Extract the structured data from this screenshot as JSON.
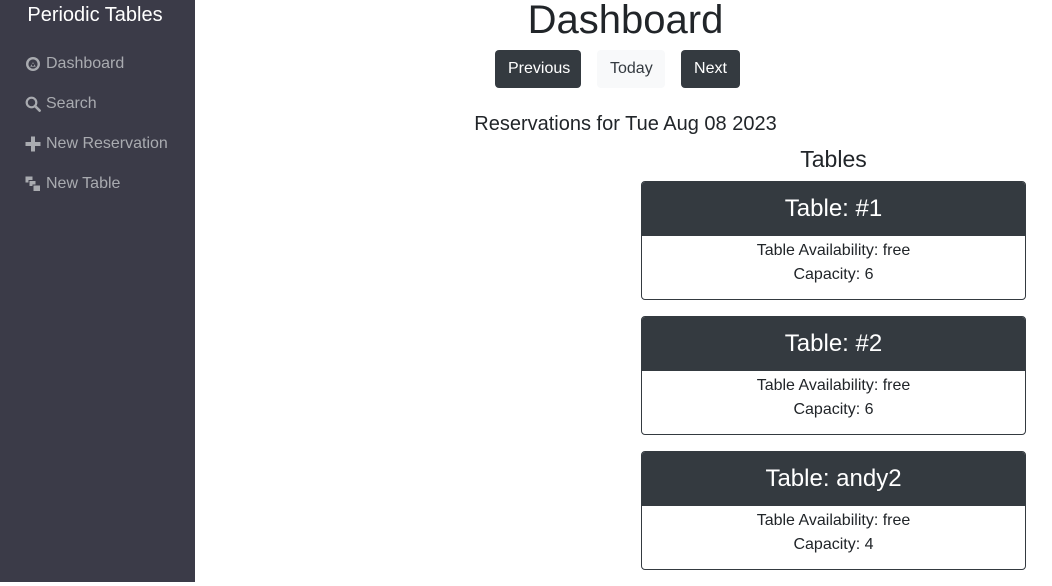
{
  "sidebar": {
    "brand": "Periodic Tables",
    "items": [
      {
        "label": "Dashboard",
        "icon": "dashboard-icon"
      },
      {
        "label": "Search",
        "icon": "search-icon"
      },
      {
        "label": "New Reservation",
        "icon": "plus-icon"
      },
      {
        "label": "New Table",
        "icon": "layers-icon"
      }
    ]
  },
  "main": {
    "title": "Dashboard",
    "buttons": {
      "previous": "Previous",
      "today": "Today",
      "next": "Next"
    },
    "reservations_heading": "Reservations for Tue Aug 08 2023",
    "tables_heading": "Tables",
    "tables": [
      {
        "title": "Table: #1",
        "availability": "Table Availability: free",
        "capacity": "Capacity: 6"
      },
      {
        "title": "Table: #2",
        "availability": "Table Availability: free",
        "capacity": "Capacity: 6"
      },
      {
        "title": "Table: andy2",
        "availability": "Table Availability: free",
        "capacity": "Capacity: 4"
      }
    ]
  },
  "colors": {
    "sidebar_bg": "#3b3b48",
    "sidebar_text": "#a9abb0",
    "dark": "#343a40",
    "light": "#f8f9fa"
  }
}
